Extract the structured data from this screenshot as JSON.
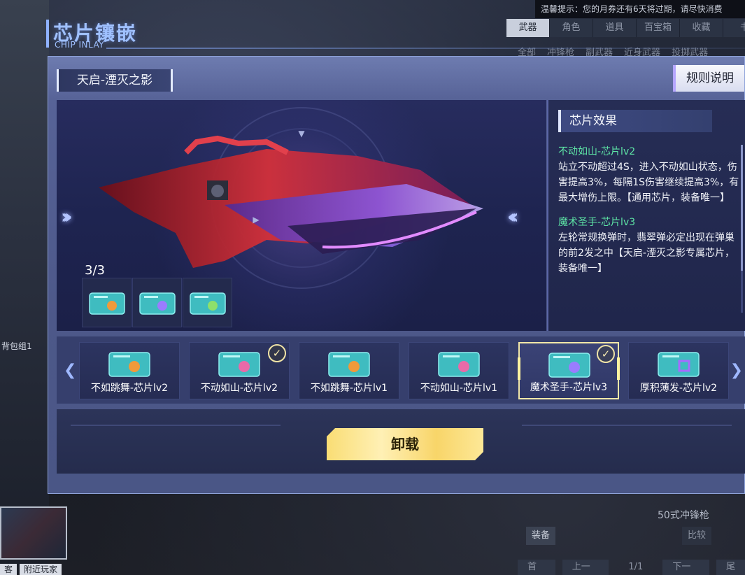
{
  "background": {
    "notice": "温馨提示：您的月券还有6天将过期，请尽快消费",
    "tabs": [
      "武器",
      "角色",
      "道具",
      "百宝箱",
      "收藏",
      "书"
    ],
    "active_tab": "武器",
    "subtabs": [
      "全部",
      "冲锋枪",
      "副武器",
      "近身武器",
      "投掷武器"
    ],
    "left_tag": "背包组1",
    "left_tabs": [
      "客",
      "附近玩家"
    ],
    "weapon_name": "50式冲锋枪",
    "equip_label": "装备",
    "compare_label": "比较",
    "pager": {
      "first": "首页",
      "prev": "上一页",
      "page": "1/1",
      "next": "下一页",
      "last": "尾"
    }
  },
  "dialog": {
    "title": "芯片镶嵌",
    "subtitle": "CHIP INLAY",
    "weapon_name": "天启-湮灭之影",
    "rules_label": "规则说明",
    "slot_count": "3/3",
    "slots": [
      "chip-icon-orange",
      "chip-icon-purple",
      "chip-icon-green"
    ],
    "effect_title": "芯片效果",
    "effects": [
      {
        "name": "不动如山-芯片lv2",
        "desc": "站立不动超过4S，进入不动如山状态，伤害提高3%，每隔1S伤害继续提高3%，有最大增伤上限。【通用芯片，装备唯一】"
      },
      {
        "name": "魔术圣手-芯片lv3",
        "desc": "左轮常规换弹时，翡翠弹必定出现在弹巢的前2发之中【天启-湮灭之影专属芯片，装备唯一】"
      }
    ],
    "chips": [
      {
        "label": "不如跳舞-芯片lv2",
        "checked": false,
        "selected": false,
        "color": "#f09a3a"
      },
      {
        "label": "不动如山-芯片lv2",
        "checked": true,
        "selected": false,
        "color": "#e86aa8"
      },
      {
        "label": "不如跳舞-芯片lv1",
        "checked": false,
        "selected": false,
        "color": "#f09a3a"
      },
      {
        "label": "不动如山-芯片lv1",
        "checked": false,
        "selected": false,
        "color": "#e86aa8"
      },
      {
        "label": "魔术圣手-芯片lv3",
        "checked": true,
        "selected": true,
        "color": "#9a7cff"
      },
      {
        "label": "厚积薄发-芯片lv2",
        "checked": false,
        "selected": false,
        "color": "#a66cff"
      }
    ],
    "unload_label": "卸载"
  },
  "colors": {
    "accent_blue": "#9fc0ff",
    "effect_name_green": "#5de3a5",
    "unload_gold": "#f9dd74",
    "selected_border": "#f3e8a8"
  }
}
